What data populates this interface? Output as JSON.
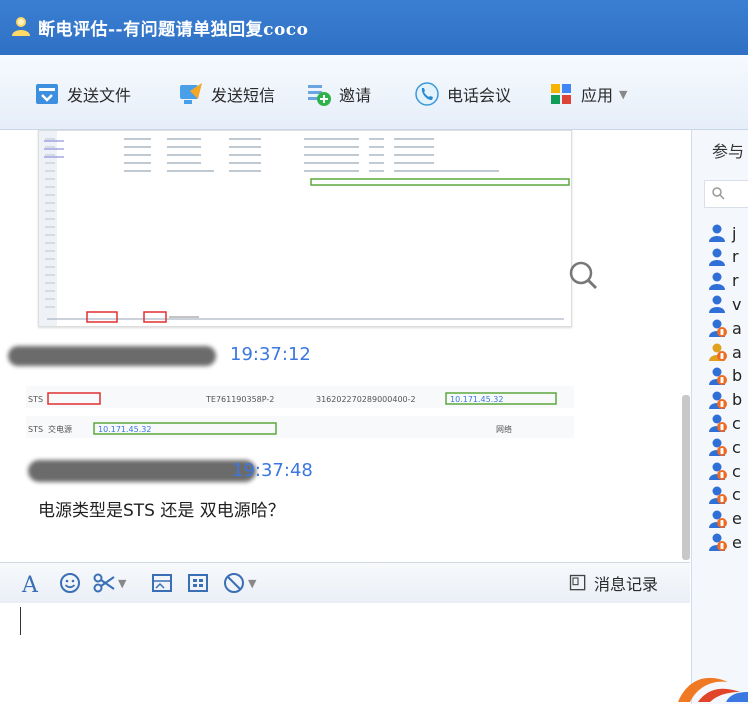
{
  "window": {
    "title": "断电评估--有问题请单独回复coco"
  },
  "toolbar": {
    "send_file": "发送文件",
    "send_sms": "发送短信",
    "invite": "邀请",
    "phone_meeting": "电话会议",
    "apps": "应用"
  },
  "chat": {
    "messages": [
      {
        "time": "19:37:12"
      },
      {
        "time": "19:37:48",
        "text": "电源类型是STS 还是 双电源哈？"
      }
    ],
    "thumbnail_small": {
      "row1": [
        "STS",
        "TE761190358P-2",
        "316202270289000400-2",
        "10.171.45.32"
      ],
      "row2": [
        "STS",
        "交电源",
        "10.171.45.32",
        "网络"
      ]
    }
  },
  "inputbar": {
    "history_label": "消息记录"
  },
  "members_panel": {
    "title": "参与",
    "members": [
      {
        "initial": "j",
        "type": "online"
      },
      {
        "initial": "r",
        "type": "online"
      },
      {
        "initial": "r",
        "type": "online"
      },
      {
        "initial": "v",
        "type": "online"
      },
      {
        "initial": "a",
        "type": "mobile"
      },
      {
        "initial": "a",
        "type": "mobile-gold"
      },
      {
        "initial": "b",
        "type": "mobile"
      },
      {
        "initial": "b",
        "type": "mobile"
      },
      {
        "initial": "c",
        "type": "mobile"
      },
      {
        "initial": "c",
        "type": "mobile"
      },
      {
        "initial": "c",
        "type": "mobile"
      },
      {
        "initial": "c",
        "type": "mobile"
      },
      {
        "initial": "e",
        "type": "mobile"
      },
      {
        "initial": "e",
        "type": "mobile"
      }
    ]
  },
  "colors": {
    "titlebar": "#3a7fd3",
    "time_text": "#3b77e0",
    "user_blue": "#2f6fd6",
    "mobile_badge": "#f06a22"
  }
}
